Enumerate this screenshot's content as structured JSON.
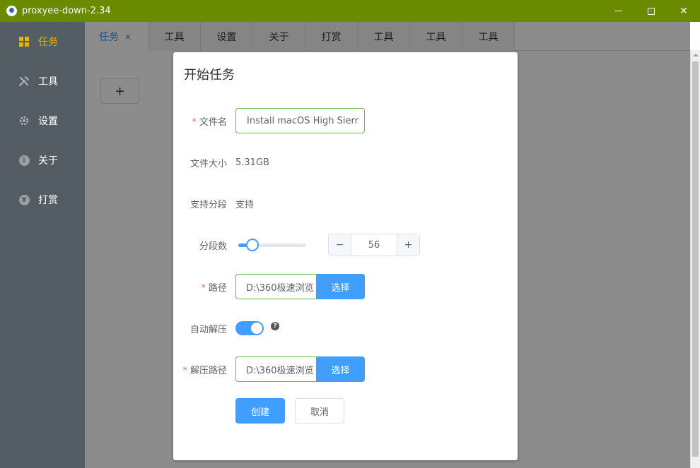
{
  "window": {
    "title": "proxyee-down-2.34",
    "minimize_icon": "minimize-icon",
    "maximize_icon": "maximize-icon",
    "close_glyph": "✕"
  },
  "sidebar": {
    "items": [
      {
        "label": "任务",
        "icon": "grid-icon",
        "active": true
      },
      {
        "label": "工具",
        "icon": "tools-icon"
      },
      {
        "label": "设置",
        "icon": "gear-icon"
      },
      {
        "label": "关于",
        "icon": "info-icon"
      },
      {
        "label": "打赏",
        "icon": "reward-icon"
      }
    ]
  },
  "tabs": {
    "items": [
      {
        "label": "任务",
        "close": "×",
        "active": true
      },
      {
        "label": "工具"
      },
      {
        "label": "设置"
      },
      {
        "label": "关于"
      },
      {
        "label": "打赏"
      },
      {
        "label": "工具"
      },
      {
        "label": "工具"
      },
      {
        "label": "工具"
      }
    ]
  },
  "main": {
    "add_label": "+"
  },
  "dialog": {
    "title": "开始任务",
    "file_name": {
      "label": "文件名",
      "value": "Install macOS High Sierr",
      "required": "*"
    },
    "file_size": {
      "label": "文件大小",
      "value": "5.31GB"
    },
    "segment_support": {
      "label": "支持分段",
      "value": "支持"
    },
    "segments": {
      "label": "分段数",
      "value": "56",
      "slider_fraction": 0.21,
      "dec": "−",
      "inc": "+"
    },
    "path": {
      "label": "路径",
      "value": "D:\\360极速浏览",
      "button": "选择",
      "required": "*"
    },
    "auto_unzip": {
      "label": "自动解压",
      "on": true,
      "help": "?"
    },
    "unzip_path": {
      "label": "解压路径",
      "value": "D:\\360极速浏览",
      "button": "选择",
      "required": "*"
    },
    "create_button": "创建",
    "cancel_button": "取消"
  }
}
